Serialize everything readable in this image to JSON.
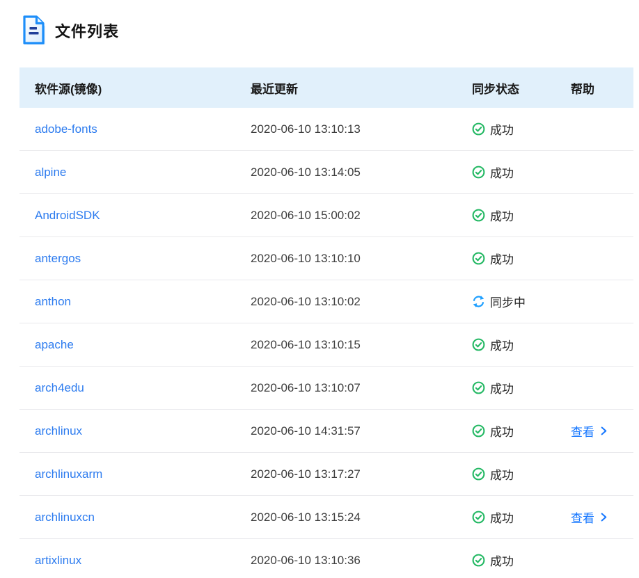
{
  "page": {
    "title": "文件列表",
    "title_icon": "document-icon"
  },
  "table": {
    "columns": [
      "软件源(镜像)",
      "最近更新",
      "同步状态",
      "帮助"
    ],
    "status_icons": {
      "success": "check-circle-icon",
      "syncing": "sync-icon"
    },
    "rows": [
      {
        "name": "adobe-fonts",
        "updated": "2020-06-10 13:10:13",
        "status": "success",
        "status_label": "成功",
        "help": ""
      },
      {
        "name": "alpine",
        "updated": "2020-06-10 13:14:05",
        "status": "success",
        "status_label": "成功",
        "help": ""
      },
      {
        "name": "AndroidSDK",
        "updated": "2020-06-10 15:00:02",
        "status": "success",
        "status_label": "成功",
        "help": ""
      },
      {
        "name": "antergos",
        "updated": "2020-06-10 13:10:10",
        "status": "success",
        "status_label": "成功",
        "help": ""
      },
      {
        "name": "anthon",
        "updated": "2020-06-10 13:10:02",
        "status": "syncing",
        "status_label": "同步中",
        "help": ""
      },
      {
        "name": "apache",
        "updated": "2020-06-10 13:10:15",
        "status": "success",
        "status_label": "成功",
        "help": ""
      },
      {
        "name": "arch4edu",
        "updated": "2020-06-10 13:10:07",
        "status": "success",
        "status_label": "成功",
        "help": ""
      },
      {
        "name": "archlinux",
        "updated": "2020-06-10 14:31:57",
        "status": "success",
        "status_label": "成功",
        "help": "查看"
      },
      {
        "name": "archlinuxarm",
        "updated": "2020-06-10 13:17:27",
        "status": "success",
        "status_label": "成功",
        "help": ""
      },
      {
        "name": "archlinuxcn",
        "updated": "2020-06-10 13:15:24",
        "status": "success",
        "status_label": "成功",
        "help": "查看"
      },
      {
        "name": "artixlinux",
        "updated": "2020-06-10 13:10:36",
        "status": "success",
        "status_label": "成功",
        "help": ""
      }
    ]
  },
  "colors": {
    "header_bg": "#e1f0fb",
    "mirror_link_blue": "#2c7bef",
    "view_link_blue": "#1677ff",
    "success_green": "#23b863",
    "sync_blue": "#1e9fff",
    "divider": "#e9e9ec",
    "title_icon_blue": "#1d8ef9"
  }
}
